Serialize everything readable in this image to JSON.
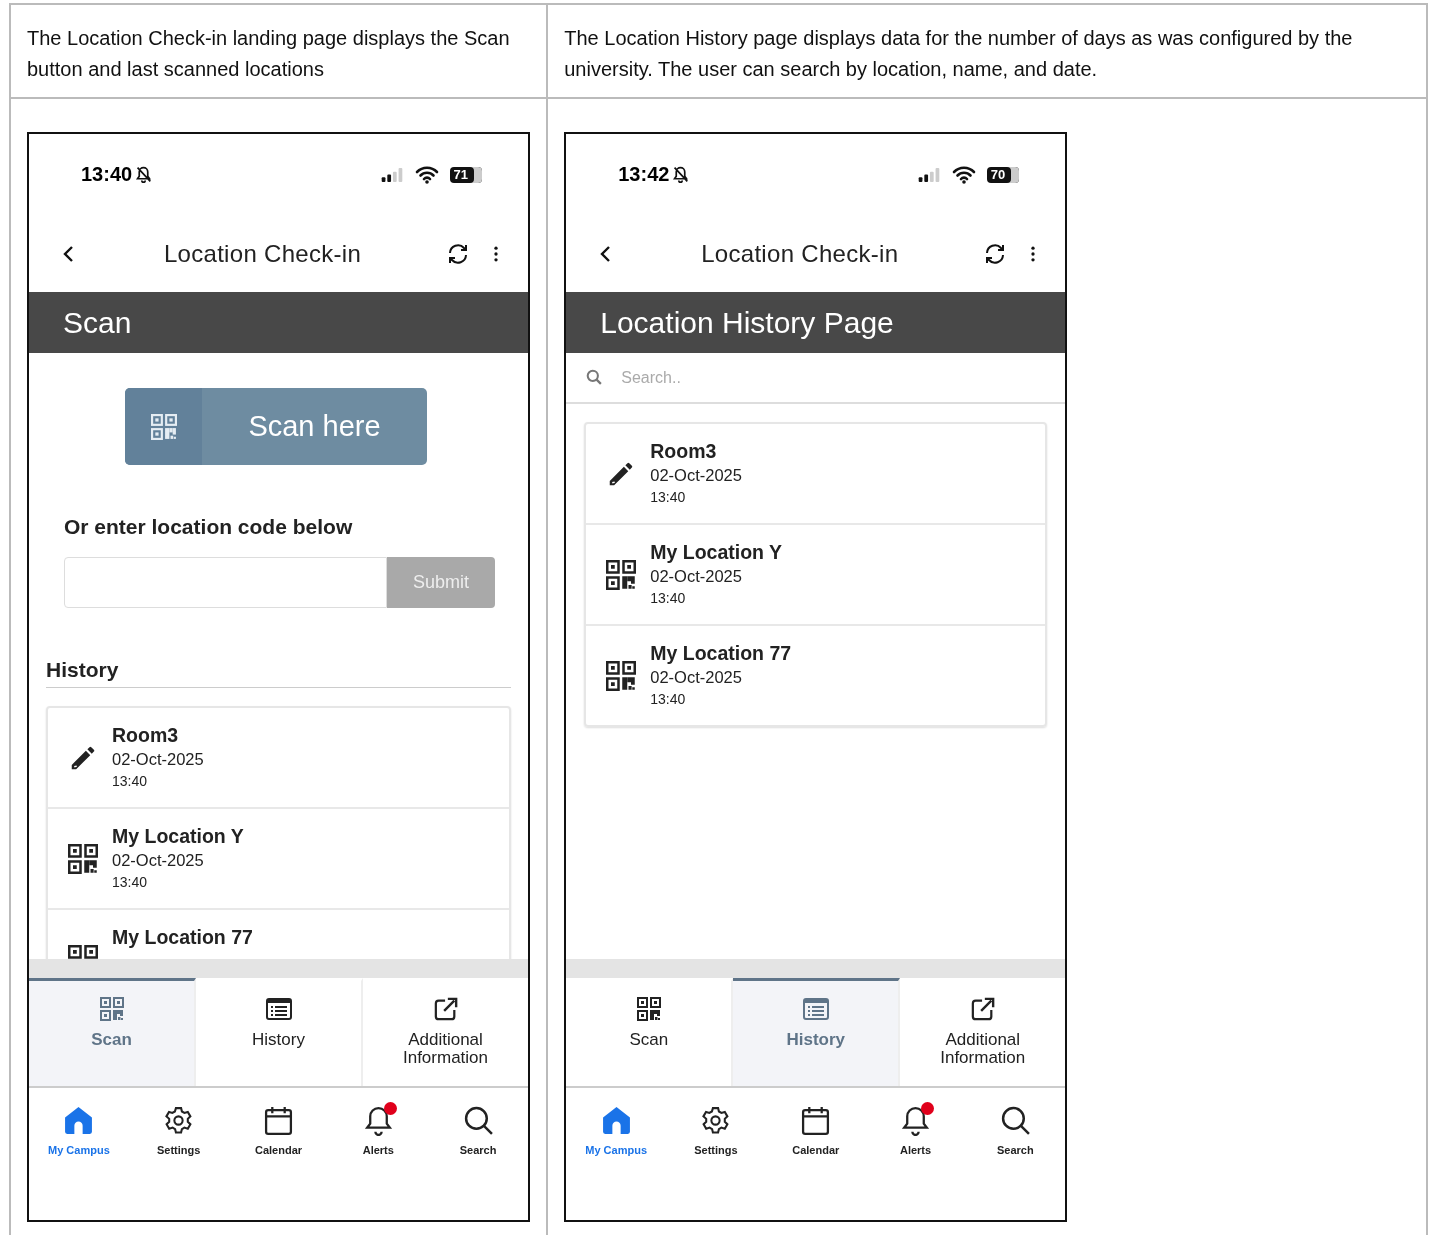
{
  "columns": [
    {
      "caption": "The Location Check-in landing page displays the Scan button and last scanned locations",
      "phone": {
        "kind": "scan",
        "time": "13:40",
        "battery": "71",
        "header_title": "Location Check-in",
        "page_title": "Scan",
        "scan_button": "Scan here",
        "code_label": "Or enter location code below",
        "submit": "Submit",
        "history_heading": "History",
        "items": [
          {
            "kind": "manual",
            "name": "Room3",
            "date": "02-Oct-2025",
            "time": "13:40"
          },
          {
            "kind": "qr",
            "name": "My Location Y",
            "date": "02-Oct-2025",
            "time": "13:40"
          },
          {
            "kind": "qr",
            "name": "My Location 77"
          }
        ],
        "tabs": [
          {
            "kind": "scan",
            "label": "Scan",
            "selected": true
          },
          {
            "kind": "history",
            "label": "History",
            "selected": false
          },
          {
            "kind": "external",
            "label": "Additional Information",
            "selected": false
          }
        ],
        "nav": [
          {
            "kind": "home",
            "label": "My Campus",
            "selected": true,
            "alert": false
          },
          {
            "kind": "settings",
            "label": "Settings",
            "selected": false,
            "alert": false
          },
          {
            "kind": "calendar",
            "label": "Calendar",
            "selected": false,
            "alert": false
          },
          {
            "kind": "alerts",
            "label": "Alerts",
            "selected": false,
            "alert": true
          },
          {
            "kind": "search",
            "label": "Search",
            "selected": false,
            "alert": false
          }
        ]
      }
    },
    {
      "caption": "The Location History page displays data for the number of days as was configured by the university. The user can search by location, name, and date.",
      "phone": {
        "kind": "history",
        "time": "13:42",
        "battery": "70",
        "header_title": "Location Check-in",
        "page_title": "Location History Page",
        "search_placeholder": "Search..",
        "items": [
          {
            "kind": "manual",
            "name": "Room3",
            "date": "02-Oct-2025",
            "time": "13:40"
          },
          {
            "kind": "qr",
            "name": "My Location Y",
            "date": "02-Oct-2025",
            "time": "13:40"
          },
          {
            "kind": "qr",
            "name": "My Location 77",
            "date": "02-Oct-2025",
            "time": "13:40"
          }
        ],
        "tabs": [
          {
            "kind": "scan",
            "label": "Scan",
            "selected": false
          },
          {
            "kind": "history",
            "label": "History",
            "selected": true
          },
          {
            "kind": "external",
            "label": "Additional Information",
            "selected": false
          }
        ],
        "nav": [
          {
            "kind": "home",
            "label": "My Campus",
            "selected": true,
            "alert": false
          },
          {
            "kind": "settings",
            "label": "Settings",
            "selected": false,
            "alert": false
          },
          {
            "kind": "calendar",
            "label": "Calendar",
            "selected": false,
            "alert": false
          },
          {
            "kind": "alerts",
            "label": "Alerts",
            "selected": false,
            "alert": true
          },
          {
            "kind": "search",
            "label": "Search",
            "selected": false,
            "alert": false
          }
        ]
      }
    }
  ]
}
